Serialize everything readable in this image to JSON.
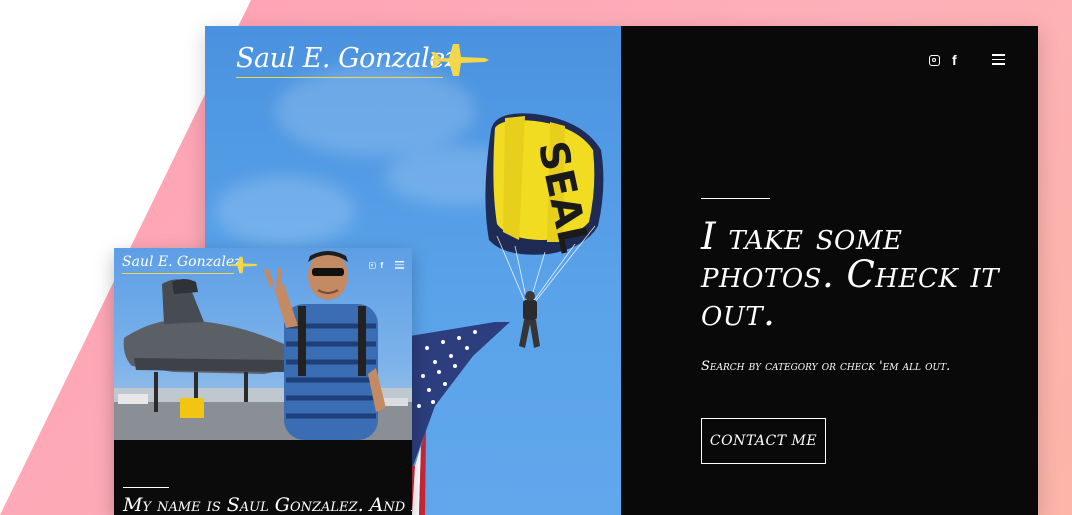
{
  "colors": {
    "panel_bg": "#090909",
    "accent_yellow": "#f3d64a",
    "sky_blue": "#4f98e3",
    "backdrop_pink": "#fda7b6"
  },
  "desktop": {
    "logo": {
      "text": "Saul E. Gonzalez",
      "icon": "fighter-jet-icon"
    },
    "social": {
      "instagram_icon": "instagram-icon",
      "facebook_glyph": "f"
    },
    "menu_icon": "hamburger-menu-icon",
    "hero": {
      "headline": "I take some photos. Check it out.",
      "subline": "Search by category or check 'em all out.",
      "button_label": "CONTACT ME"
    },
    "photo": {
      "canopy_text": "SEAL"
    }
  },
  "mobile": {
    "logo": {
      "text": "Saul E. Gonzalez",
      "icon": "fighter-jet-icon"
    },
    "social": {
      "instagram_icon": "instagram-icon",
      "facebook_glyph": "f"
    },
    "menu_icon": "hamburger-menu-icon",
    "headline": "My name is Saul Gonzalez. And I"
  }
}
